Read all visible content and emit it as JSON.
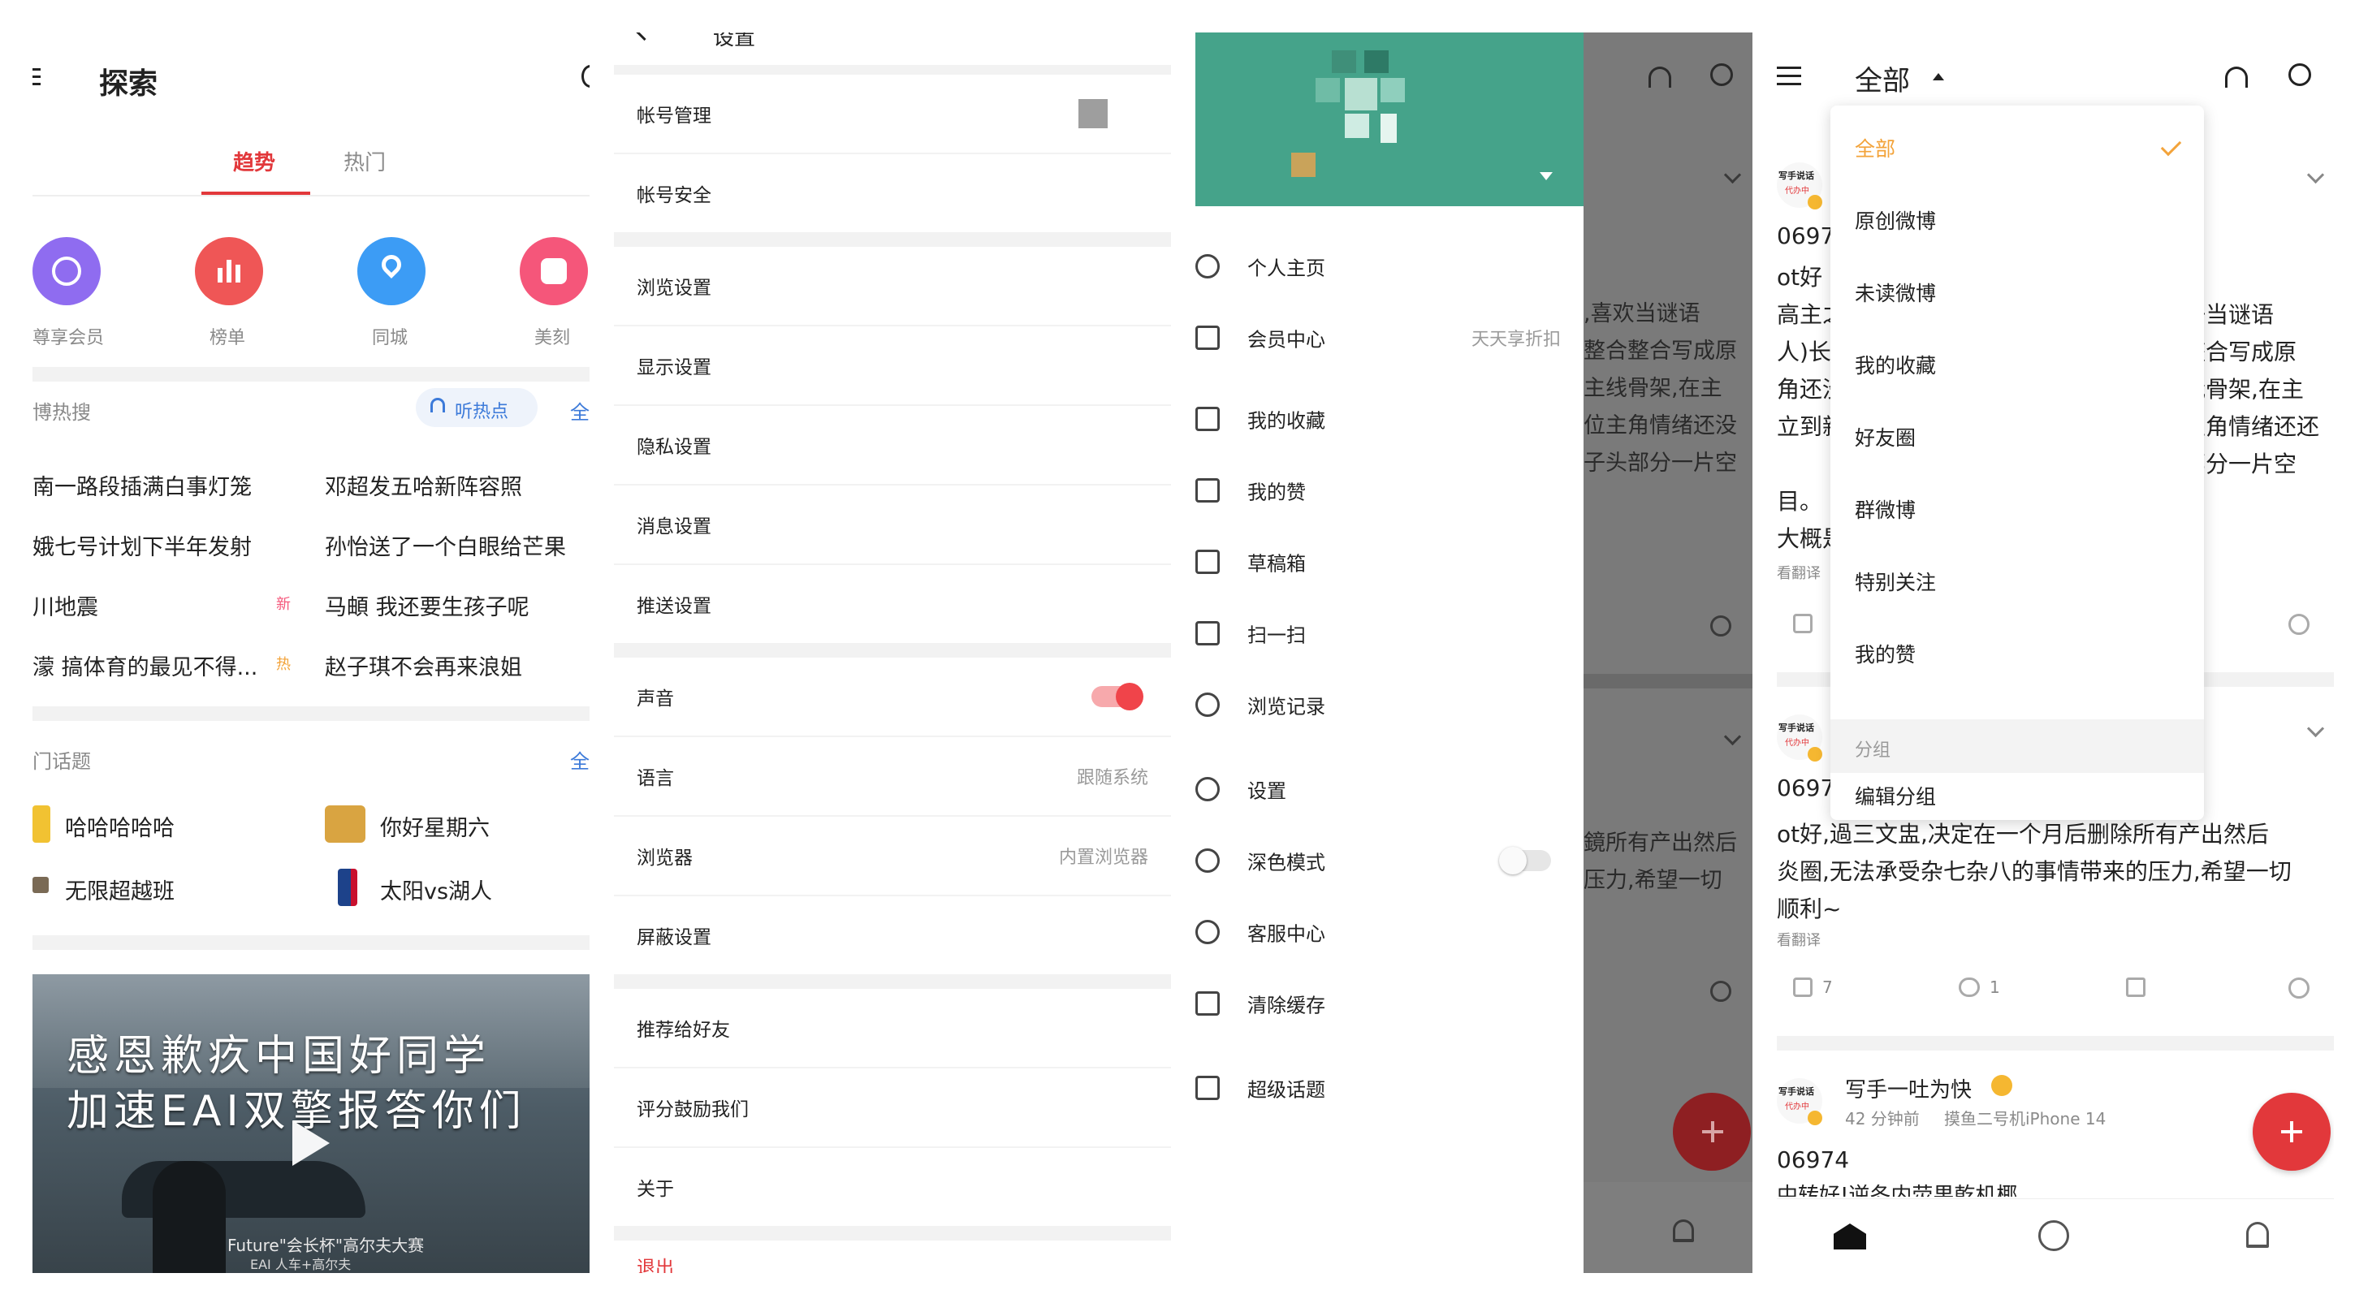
{
  "p1": {
    "title": "探索",
    "tabs": [
      "趋势",
      "热门"
    ],
    "shortcuts": [
      {
        "label": "尊享会员",
        "color": "#8f6cf0"
      },
      {
        "label": "榜单",
        "color": "#ef5656"
      },
      {
        "label": "同城",
        "color": "#3c9cf5"
      },
      {
        "label": "美刻",
        "color": "#f5567a"
      }
    ],
    "hot_search_title": "博热搜",
    "listen_label": "听热点",
    "all_label": "全",
    "hot_items": [
      {
        "text": "南一路段插满白事灯笼",
        "badge": ""
      },
      {
        "text": "邓超发五哈新阵容照",
        "badge": ""
      },
      {
        "text": "娥七号计划下半年发射",
        "badge": ""
      },
      {
        "text": "孙怡送了一个白眼给芒果",
        "badge": ""
      },
      {
        "text": "川地震",
        "badge": "新"
      },
      {
        "text": "马頔 我还要生孩子呢",
        "badge": ""
      },
      {
        "text": "濛 搞体育的最见不得...",
        "badge": "热"
      },
      {
        "text": "赵子琪不会再来浪姐",
        "badge": ""
      }
    ],
    "topics_title": "门话题",
    "topics": [
      "哈哈哈哈哈",
      "你好星期六",
      "无限超越班",
      "太阳vs湖人"
    ],
    "banner": {
      "line1": "感恩歉疚中国好同学",
      "line2": "加速EAI双擎报答你们",
      "caption1": "Future\"会长杯\"高尔夫大赛",
      "caption2": "EAI 人车+高尔夫"
    }
  },
  "p2": {
    "header": "设置",
    "groups": [
      [
        {
          "label": "帐号管理",
          "value": ""
        },
        {
          "label": "帐号安全",
          "value": ""
        }
      ],
      [
        {
          "label": "浏览设置",
          "value": ""
        },
        {
          "label": "显示设置",
          "value": ""
        },
        {
          "label": "隐私设置",
          "value": ""
        },
        {
          "label": "消息设置",
          "value": ""
        },
        {
          "label": "推送设置",
          "value": ""
        }
      ],
      [
        {
          "label": "声音",
          "value": ""
        },
        {
          "label": "语言",
          "value": "跟随系统"
        },
        {
          "label": "浏览器",
          "value": "内置浏览器"
        },
        {
          "label": "屏蔽设置",
          "value": ""
        }
      ],
      [
        {
          "label": "推荐给好友",
          "value": ""
        },
        {
          "label": "评分鼓励我们",
          "value": ""
        },
        {
          "label": "关于",
          "value": ""
        }
      ]
    ],
    "logout": "退出"
  },
  "p3": {
    "menu": [
      {
        "label": "个人主页",
        "value": "",
        "icon": "user-icon"
      },
      {
        "label": "会员中心",
        "value": "天天享折扣",
        "icon": "crown-icon"
      },
      {
        "label": "我的收藏",
        "value": "",
        "icon": "star-icon"
      },
      {
        "label": "我的赞",
        "value": "",
        "icon": "thumb-up-icon"
      },
      {
        "label": "草稿箱",
        "value": "",
        "icon": "draft-icon"
      },
      {
        "label": "扫一扫",
        "value": "",
        "icon": "scan-icon"
      },
      {
        "label": "浏览记录",
        "value": "",
        "icon": "clock-icon"
      },
      {
        "label": "设置",
        "value": "",
        "icon": "gear-icon"
      },
      {
        "label": "深色模式",
        "value": "",
        "icon": "moon-icon"
      },
      {
        "label": "客服中心",
        "value": "",
        "icon": "headset-icon"
      },
      {
        "label": "清除缓存",
        "value": "",
        "icon": "eraser-icon"
      },
      {
        "label": "超级话题",
        "value": "",
        "icon": "diamond-icon"
      }
    ],
    "bg_lines": [
      ",喜欢当谜语",
      "整合整合写成原",
      "主线骨架,在主",
      "位主角情绪还没",
      "子头部分一片空",
      "鏡所有产出然后",
      "压力,希望一切"
    ]
  },
  "p4": {
    "header": "全部",
    "dropdown": [
      "全部",
      "原创微博",
      "未读微博",
      "我的收藏",
      "好友圈",
      "群微博",
      "特别关注",
      "我的赞"
    ],
    "group_header": "分组",
    "edit_group": "编辑分组",
    "left_fragments": [
      "0697",
      "ot好",
      "高主之",
      "人)长",
      "角还没",
      "立到新",
      "目。",
      "大概是",
      "看翻译"
    ],
    "right_fragments": [
      "好当谜语",
      "整合写成原",
      "我骨架,在主",
      "主角情绪还还",
      "部分一片空"
    ],
    "post2": {
      "name_frag": "0697",
      "line1": "ot好,過三文盅,决定在一个月后删除所有产出然后",
      "line2": "炎圈,无法承受杂七杂八的事情带来的压力,希望一切",
      "line3": "顺利~",
      "translate": "看翻译",
      "likes": "7",
      "comments": "1"
    },
    "post3": {
      "name": "写手一吐为快",
      "time": "42 分钟前",
      "source": "摸鱼二号机iPhone 14",
      "text": "06974",
      "text2": "中转好!逆冬内荧果乾机椰"
    },
    "avatar_text": "写手说话",
    "avatar_sub": "代办中"
  }
}
